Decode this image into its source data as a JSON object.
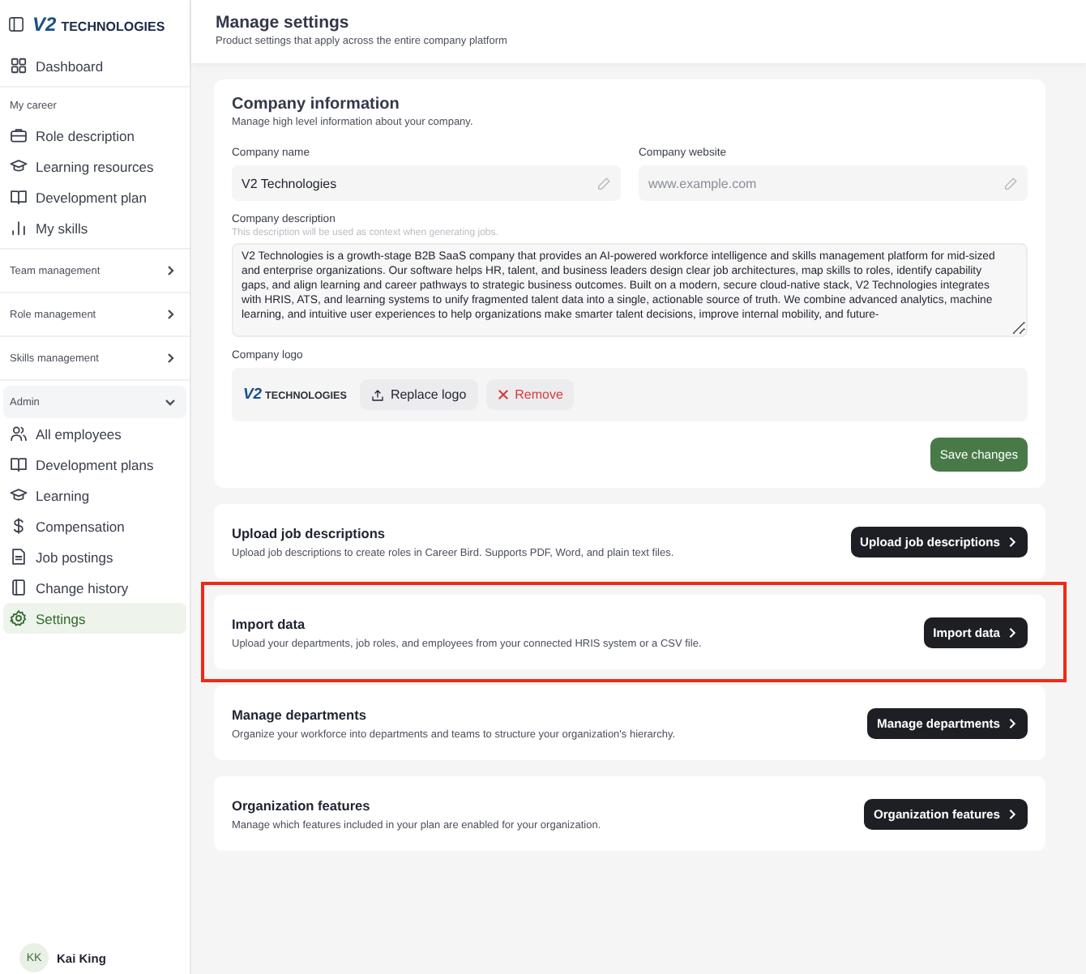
{
  "sidebar": {
    "logo": {
      "mark": "V2",
      "word": "TECHNOLOGIES"
    },
    "sections": [
      {
        "kind": "plain",
        "items": [
          {
            "label": "Dashboard",
            "selected": false
          }
        ]
      },
      {
        "kind": "labelled",
        "label": "My career",
        "items": [
          {
            "label": "Role description",
            "selected": false
          },
          {
            "label": "Learning resources",
            "selected": false
          },
          {
            "label": "Development plan",
            "selected": false
          },
          {
            "label": "My skills",
            "selected": false
          }
        ]
      },
      {
        "kind": "group",
        "label": "Team management",
        "expanded": false
      },
      {
        "kind": "group",
        "label": "Role management",
        "expanded": false
      },
      {
        "kind": "group",
        "label": "Skills management",
        "expanded": false
      },
      {
        "kind": "group",
        "label": "Admin",
        "expanded": true,
        "items": [
          {
            "label": "All employees",
            "selected": false
          },
          {
            "label": "Development plans",
            "selected": false
          },
          {
            "label": "Learning",
            "selected": false
          },
          {
            "label": "Compensation",
            "selected": false
          },
          {
            "label": "Job postings",
            "selected": false
          },
          {
            "label": "Change history",
            "selected": false
          },
          {
            "label": "Settings",
            "selected": true
          }
        ]
      }
    ],
    "user": {
      "initials": "KK",
      "name": "Kai King"
    }
  },
  "header": {
    "title": "Manage settings",
    "subtitle": "Product settings that apply across the entire company platform"
  },
  "company_info": {
    "title": "Company information",
    "subtitle": "Manage high level information about your company.",
    "name_field": {
      "label": "Company name",
      "value": "V2 Technologies"
    },
    "website_field": {
      "label": "Company website",
      "placeholder": "www.example.com"
    },
    "description": {
      "label": "Company description",
      "hint": "This description will be used as context when generating jobs.",
      "value": "V2 Technologies is a growth-stage B2B SaaS company that provides an AI-powered workforce intelligence and skills management platform for mid-sized and enterprise organizations. Our software helps HR, talent, and business leaders design clear job architectures, map skills to roles, identify capability gaps, and align learning and career pathways to strategic business outcomes. Built on a modern, secure cloud-native stack, V2 Technologies integrates with HRIS, ATS, and learning systems to unify fragmented talent data into a single, actionable source of truth. We combine advanced analytics, machine learning, and intuitive user experiences to help organizations make smarter talent decisions, improve internal mobility, and future-"
    },
    "logo": {
      "label": "Company logo",
      "mark": "V2",
      "word": "TECHNOLOGIES",
      "replace_button": "Replace logo",
      "remove_button": "Remove"
    },
    "save_button": "Save changes"
  },
  "actions": [
    {
      "title": "Upload job descriptions",
      "description": "Upload job descriptions to create roles in Career Bird. Supports PDF, Word, and plain text files.",
      "button": "Upload job descriptions",
      "highlighted": false
    },
    {
      "title": "Import data",
      "description": "Upload your departments, job roles, and employees from your connected HRIS system or a CSV file.",
      "button": "Import data",
      "highlighted": true
    },
    {
      "title": "Manage departments",
      "description": "Organize your workforce into departments and teams to structure your organization's hierarchy.",
      "button": "Manage departments",
      "highlighted": false
    },
    {
      "title": "Organization features",
      "description": "Manage which features included in your plan are enabled for your organization.",
      "button": "Organization features",
      "highlighted": false
    }
  ]
}
